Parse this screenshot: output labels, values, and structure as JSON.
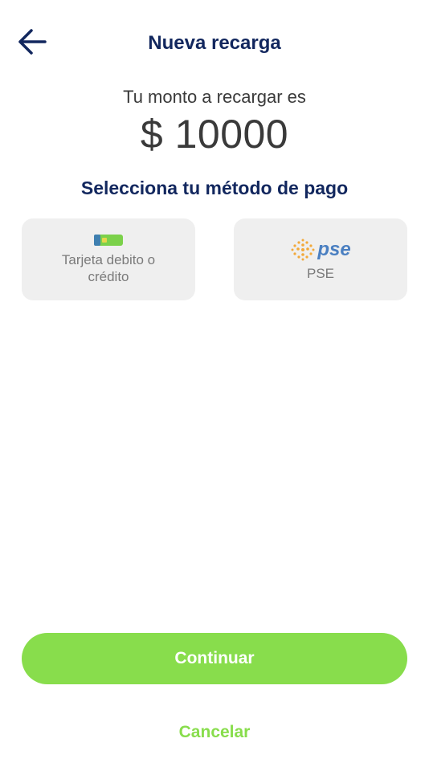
{
  "header": {
    "title": "Nueva recarga",
    "back_icon": "arrow-left-icon"
  },
  "amount": {
    "label": "Tu monto a recargar es",
    "value": "$ 10000"
  },
  "payment": {
    "section_title": "Selecciona tu método de pago",
    "methods": [
      {
        "label": "Tarjeta debito o crédito",
        "icon": "credit-card-icon"
      },
      {
        "label": "PSE",
        "icon": "pse-logo-icon",
        "logo_text": "pse"
      }
    ]
  },
  "actions": {
    "continue_label": "Continuar",
    "cancel_label": "Cancelar"
  },
  "colors": {
    "primary_navy": "#12275e",
    "accent_green": "#88dd4c",
    "card_background": "#efefef",
    "pse_blue": "#4a7fc1",
    "pse_orange": "#f2a93b"
  }
}
